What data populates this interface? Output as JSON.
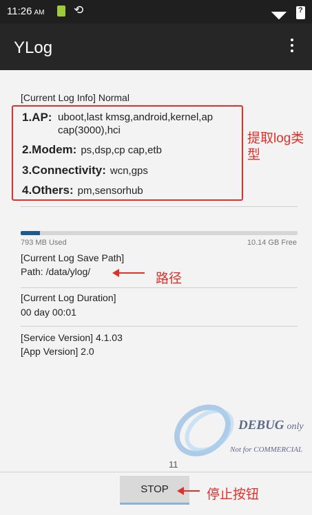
{
  "status_bar": {
    "time": "11:26",
    "ampm": "AM",
    "icons": [
      "sim-card-icon",
      "sync-icon",
      "signal-icon",
      "battery-unknown-icon"
    ]
  },
  "app_bar": {
    "title": "YLog",
    "overflow_icon": "more-vert-icon"
  },
  "log_info": {
    "header": "[Current Log Info] Normal",
    "types": [
      {
        "label": "1.AP:",
        "value": "uboot,last kmsg,android,kernel,ap cap(3000),hci"
      },
      {
        "label": "2.Modem:",
        "value": "ps,dsp,cp cap,etb"
      },
      {
        "label": "3.Connectivity:",
        "value": "wcn,gps"
      },
      {
        "label": "4.Others:",
        "value": "pm,sensorhub"
      }
    ],
    "annotation": "提取log类型"
  },
  "storage": {
    "used": "793 MB Used",
    "free": "10.14 GB Free",
    "used_fraction": 0.07
  },
  "save_path": {
    "header": "[Current Log Save Path]",
    "value": "Path: /data/ylog/",
    "annotation": "路径"
  },
  "duration": {
    "header": "[Current Log Duration]",
    "value": "00 day 00:01"
  },
  "versions": {
    "service": "[Service Version]  4.1.03",
    "app": "[App Version]  2.0"
  },
  "watermark": {
    "main": "DEBUG",
    "suffix": "only",
    "sub": "Not for COMMERCIAL"
  },
  "page_count": "11",
  "bottom": {
    "stop_label": "STOP",
    "annotation": "停止按钮"
  },
  "colors": {
    "status_bg": "#1f1f1f",
    "appbar_bg": "#262626",
    "annotation_red": "#e0302a",
    "progress_fill": "#1f5a8a"
  }
}
